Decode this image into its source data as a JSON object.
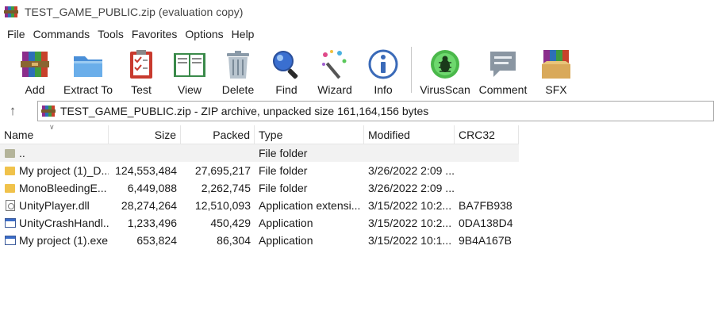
{
  "window": {
    "title": "TEST_GAME_PUBLIC.zip (evaluation copy)"
  },
  "menu": [
    "File",
    "Commands",
    "Tools",
    "Favorites",
    "Options",
    "Help"
  ],
  "toolbar": [
    {
      "label": "Add",
      "icon": "books-add-icon"
    },
    {
      "label": "Extract To",
      "icon": "folder-extract-icon"
    },
    {
      "label": "Test",
      "icon": "clipboard-check-icon"
    },
    {
      "label": "View",
      "icon": "open-book-icon"
    },
    {
      "label": "Delete",
      "icon": "trash-can-icon"
    },
    {
      "label": "Find",
      "icon": "magnifier-icon"
    },
    {
      "label": "Wizard",
      "icon": "magic-wand-icon"
    },
    {
      "label": "Info",
      "icon": "info-icon"
    },
    {
      "label": "VirusScan",
      "icon": "bug-scan-icon"
    },
    {
      "label": "Comment",
      "icon": "comment-icon"
    },
    {
      "label": "SFX",
      "icon": "sfx-box-icon"
    }
  ],
  "address": {
    "text": "TEST_GAME_PUBLIC.zip - ZIP archive, unpacked size 161,164,156 bytes"
  },
  "columns": {
    "name": "Name",
    "size": "Size",
    "packed": "Packed",
    "type": "Type",
    "modified": "Modified",
    "crc": "CRC32"
  },
  "rows": [
    {
      "name": "..",
      "size": "",
      "packed": "",
      "type": "File folder",
      "modified": "",
      "crc": "",
      "icon": "parent-folder-icon"
    },
    {
      "name": "My project (1)_D...",
      "size": "124,553,484",
      "packed": "27,695,217",
      "type": "File folder",
      "modified": "3/26/2022 2:09 ...",
      "crc": "",
      "icon": "folder-icon"
    },
    {
      "name": "MonoBleedingE...",
      "size": "6,449,088",
      "packed": "2,262,745",
      "type": "File folder",
      "modified": "3/26/2022 2:09 ...",
      "crc": "",
      "icon": "folder-icon"
    },
    {
      "name": "UnityPlayer.dll",
      "size": "28,274,264",
      "packed": "12,510,093",
      "type": "Application extensi...",
      "modified": "3/15/2022 10:2...",
      "crc": "BA7FB938",
      "icon": "dll-file-icon"
    },
    {
      "name": "UnityCrashHandl...",
      "size": "1,233,496",
      "packed": "450,429",
      "type": "Application",
      "modified": "3/15/2022 10:2...",
      "crc": "0DA138D4",
      "icon": "exe-file-icon"
    },
    {
      "name": "My project (1).exe",
      "size": "653,824",
      "packed": "86,304",
      "type": "Application",
      "modified": "3/15/2022 10:1...",
      "crc": "9B4A167B",
      "icon": "exe-file-icon"
    }
  ],
  "colors": {
    "folder": "#f0c24b",
    "parent_row_bg": "#f2f2f2",
    "separator": "#e5e5e5"
  }
}
